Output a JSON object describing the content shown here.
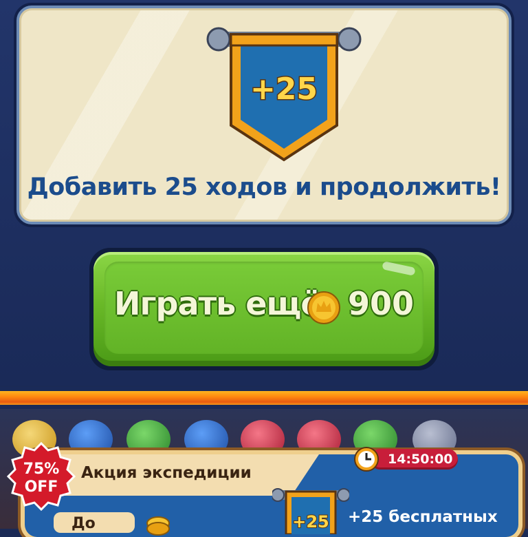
{
  "panel": {
    "banner_value": "+25",
    "title": "Добавить 25 ходов и продолжить!"
  },
  "play_button": {
    "label": "Играть ещё",
    "icon": "gold-coin-icon",
    "price": "900"
  },
  "promo": {
    "discount_badge_line1": "75%",
    "discount_badge_line2": "OFF",
    "title": "Акция экспедиции",
    "timer": "14:50:00",
    "timer_icon": "clock-icon",
    "banner_value": "+25",
    "offer_text": "+25 бесплатных",
    "slot_text": "До"
  },
  "colors": {
    "title_blue": "#1b4c8c",
    "button_green": "#6ab928",
    "banner_blue": "#1f6fb0",
    "banner_gold": "#f2a21b",
    "timer_red": "#c81e3a"
  }
}
